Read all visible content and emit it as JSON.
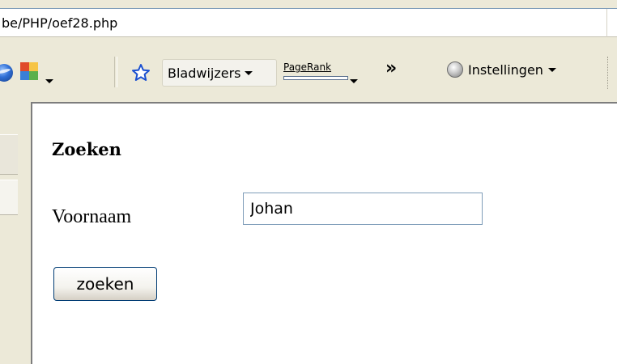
{
  "address_bar": {
    "url": "be/PHP/oef28.php"
  },
  "toolbar": {
    "bookmarks_label": "Bladwijzers",
    "pagerank_label": "PageRank",
    "more_label": "»",
    "settings_label": "Instellingen",
    "icons": [
      "globe-icon",
      "puzzle-icon",
      "star-icon",
      "chevron-down-icon",
      "gear-icon"
    ]
  },
  "form": {
    "heading": "Zoeken",
    "field_label": "Voornaam",
    "field_value": "Johan",
    "submit_label": "zoeken"
  }
}
